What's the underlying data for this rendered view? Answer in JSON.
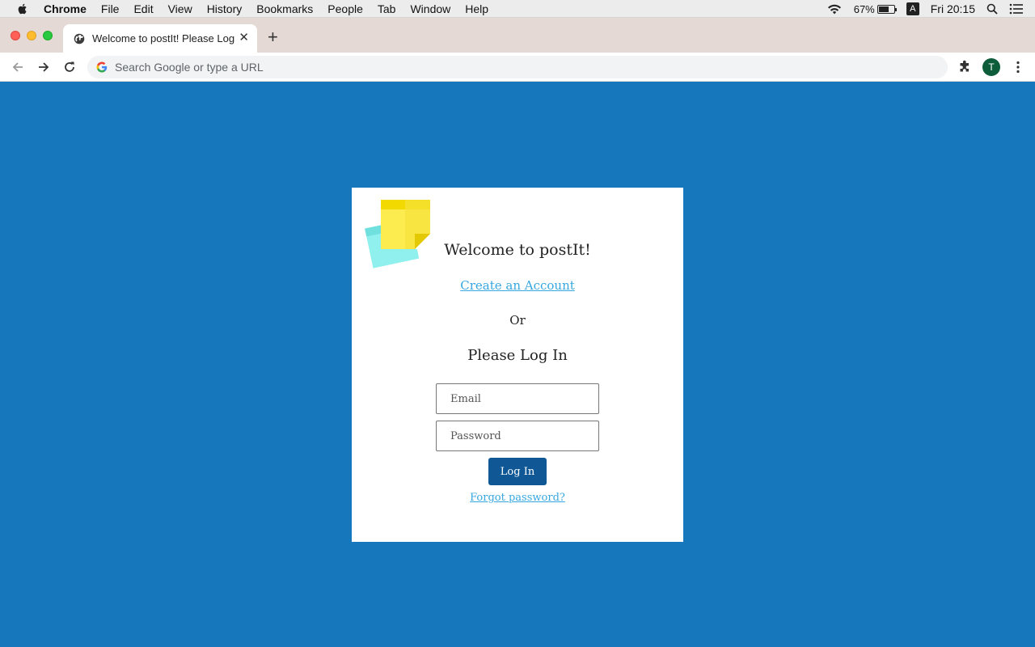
{
  "menubar": {
    "app_name": "Chrome",
    "items": [
      "File",
      "Edit",
      "View",
      "History",
      "Bookmarks",
      "People",
      "Tab",
      "Window",
      "Help"
    ],
    "battery_percent": "67%",
    "battery_level": 0.67,
    "input_source": "A",
    "clock": "Fri 20:15",
    "icons": [
      "apple-icon",
      "wifi-icon",
      "battery-icon",
      "spotlight-icon",
      "control-center-icon"
    ]
  },
  "browser": {
    "tab_title": "Welcome to postIt! Please Log In",
    "omnibox_placeholder": "Search Google or type a URL",
    "profile_initial": "T"
  },
  "page": {
    "background_color": "#1777bd",
    "welcome_heading": "Welcome to postIt!",
    "create_account_link": "Create an Account",
    "or_text": "Or",
    "login_heading": "Please Log In",
    "email_placeholder": "Email",
    "password_placeholder": "Password",
    "login_button": "Log In",
    "forgot_link": "Forgot password?",
    "accent_color": "#37a7e0",
    "button_color": "#0f5895"
  }
}
